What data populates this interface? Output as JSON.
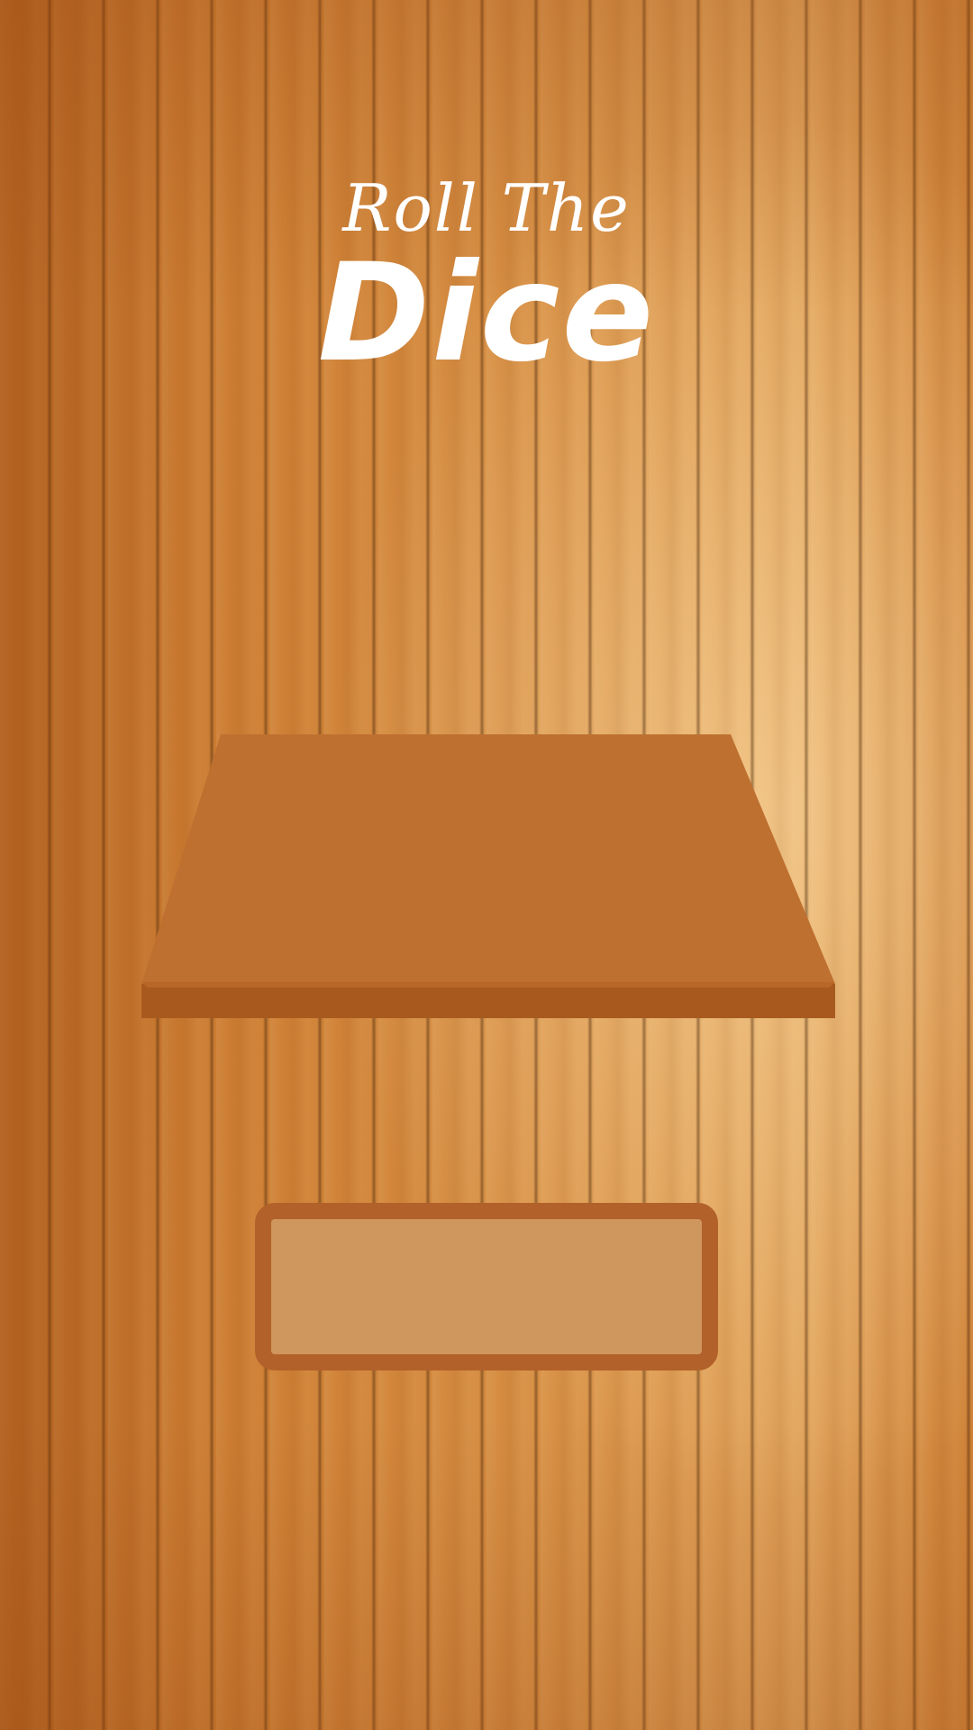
{
  "app": {
    "title_line1": "Roll The",
    "title_line2": "Dice"
  },
  "roll_button": {
    "label": ""
  },
  "colors": {
    "wood_background": "#d18a3f",
    "board_top": "#be7030",
    "board_edge": "#a85a1e",
    "button_fill": "#cf965e",
    "button_border": "#b2612a",
    "title_text": "#ffffff"
  }
}
